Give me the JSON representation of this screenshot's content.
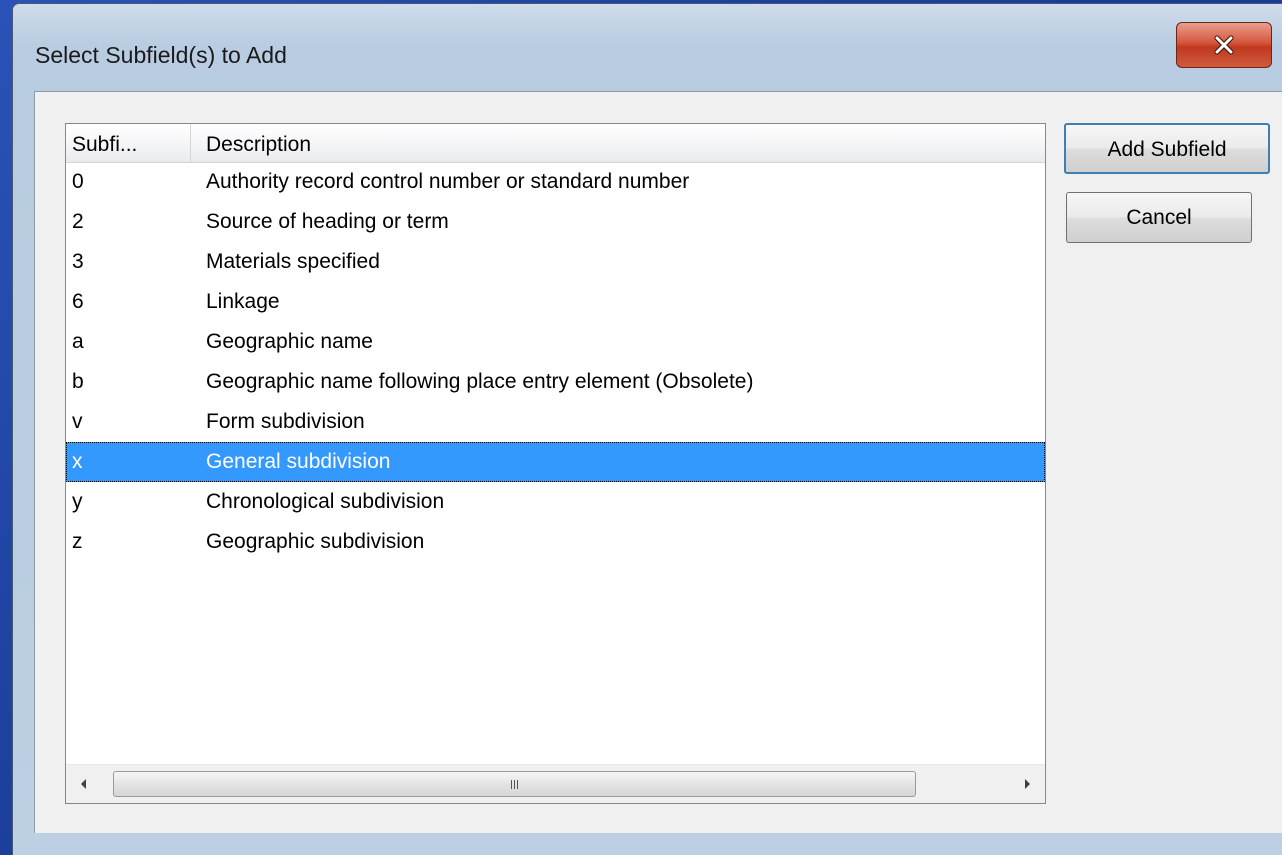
{
  "window": {
    "title": "Select Subfield(s) to Add",
    "close_label": "x"
  },
  "list": {
    "columns": [
      "Subfi...",
      "Description"
    ],
    "rows": [
      {
        "code": "0",
        "description": "Authority record control number or standard number"
      },
      {
        "code": "2",
        "description": "Source of heading or term"
      },
      {
        "code": "3",
        "description": "Materials specified"
      },
      {
        "code": "6",
        "description": "Linkage"
      },
      {
        "code": "a",
        "description": "Geographic name"
      },
      {
        "code": "b",
        "description": "Geographic name following place entry element (Obsolete)"
      },
      {
        "code": "v",
        "description": "Form subdivision"
      },
      {
        "code": "x",
        "description": "General subdivision"
      },
      {
        "code": "y",
        "description": "Chronological subdivision"
      },
      {
        "code": "z",
        "description": "Geographic subdivision"
      }
    ],
    "selected_code": "x"
  },
  "buttons": {
    "add_label": "Add Subfield",
    "cancel_label": "Cancel"
  },
  "icons": {
    "close": "close-icon",
    "scroll_left": "scroll-left-arrow-icon",
    "scroll_right": "scroll-right-arrow-icon",
    "thumb_grip": "scroll-grip-icon"
  },
  "colors": {
    "selection": "#3399ff",
    "close_button": "#c8452a",
    "desktop": "#1b3f9a"
  }
}
